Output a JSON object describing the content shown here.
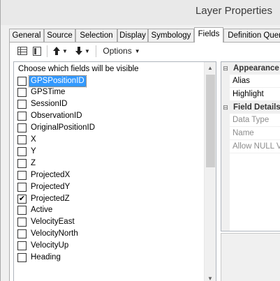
{
  "window": {
    "title": "Layer Properties"
  },
  "tabs": [
    {
      "label": "General"
    },
    {
      "label": "Source"
    },
    {
      "label": "Selection"
    },
    {
      "label": "Display"
    },
    {
      "label": "Symbology"
    },
    {
      "label": "Fields",
      "active": true
    },
    {
      "label": "Definition Query"
    }
  ],
  "toolbar": {
    "options_label": "Options",
    "dropdown_caret": "▼",
    "up_arrow": "🡅",
    "down_arrow": "🡇"
  },
  "fields_list": {
    "header": "Choose which fields will be visible",
    "items": [
      {
        "name": "GPSPositionID",
        "checked": false,
        "selected": true
      },
      {
        "name": "GPSTime",
        "checked": false
      },
      {
        "name": "SessionID",
        "checked": false
      },
      {
        "name": "ObservationID",
        "checked": false
      },
      {
        "name": "OriginalPositionID",
        "checked": false
      },
      {
        "name": "X",
        "checked": false
      },
      {
        "name": "Y",
        "checked": false
      },
      {
        "name": "Z",
        "checked": false
      },
      {
        "name": "ProjectedX",
        "checked": false
      },
      {
        "name": "ProjectedY",
        "checked": false
      },
      {
        "name": "ProjectedZ",
        "checked": true
      },
      {
        "name": "Active",
        "checked": false
      },
      {
        "name": "VelocityEast",
        "checked": false
      },
      {
        "name": "VelocityNorth",
        "checked": false
      },
      {
        "name": "VelocityUp",
        "checked": false
      },
      {
        "name": "Heading",
        "checked": false
      }
    ]
  },
  "property_grid": {
    "appearance": {
      "label": "Appearance",
      "rows": [
        {
          "label": "Alias"
        },
        {
          "label": "Highlight"
        }
      ]
    },
    "field_details": {
      "label": "Field Details",
      "rows": [
        {
          "label": "Data Type"
        },
        {
          "label": "Name"
        },
        {
          "label": "Allow NULL V"
        }
      ]
    }
  },
  "colors": {
    "selection": "#3399ff",
    "window_bg": "#f0f0f0",
    "border": "#adadad"
  },
  "icons": {
    "check": "✔",
    "collapse": "⊟",
    "scroll_up": "▲",
    "scroll_down": "▼"
  }
}
